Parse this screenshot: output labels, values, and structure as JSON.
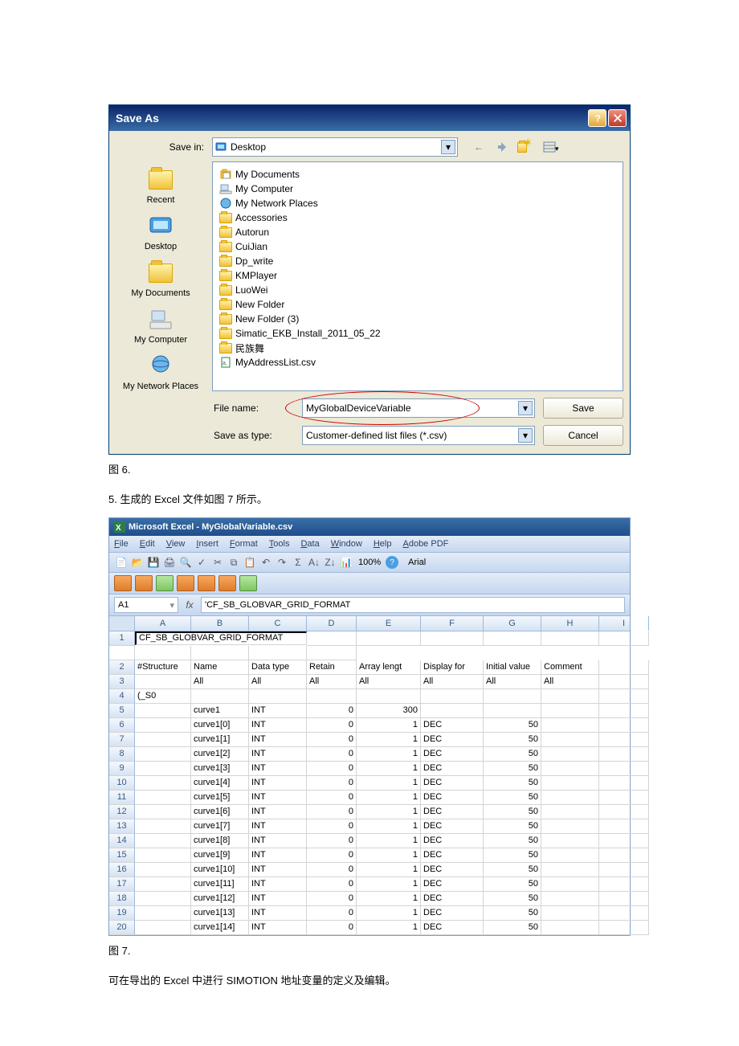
{
  "saveas": {
    "title": "Save As",
    "savein_lbl": "Save in:",
    "savein_val": "Desktop",
    "places": [
      "Recent",
      "Desktop",
      "My Documents",
      "My Computer",
      "My Network Places"
    ],
    "items": [
      "My Documents",
      "My Computer",
      "My Network Places",
      "Accessories",
      "Autorun",
      "CuiJian",
      "Dp_write",
      "KMPlayer",
      "LuoWei",
      "New Folder",
      "New Folder (3)",
      "Simatic_EKB_Install_2011_05_22",
      "民族舞",
      "MyAddressList.csv"
    ],
    "filename_lbl": "File name:",
    "filename_val": "MyGlobalDeviceVariable",
    "savetype_lbl": "Save as type:",
    "savetype_val": "Customer-defined list files (*.csv)",
    "save_btn": "Save",
    "cancel_btn": "Cancel"
  },
  "caption1": "图 6.",
  "para1": "5.  生成的 Excel 文件如图 7 所示。",
  "excel": {
    "title": "Microsoft Excel - MyGlobalVariable.csv",
    "menus": [
      "File",
      "Edit",
      "View",
      "Insert",
      "Format",
      "Tools",
      "Data",
      "Window",
      "Help",
      "Adobe PDF"
    ],
    "zoom": "100%",
    "font": "Arial",
    "namebox": "A1",
    "formula": "'CF_SB_GLOBVAR_GRID_FORMAT",
    "cols": [
      "",
      "A",
      "B",
      "C",
      "D",
      "E",
      "F",
      "G",
      "H",
      "I"
    ],
    "rows": [
      {
        "n": "1",
        "A": "CF_SB_GLOBVAR_GRID_FORMAT",
        "cur": true
      },
      {
        "n": "2",
        "A": "#Structure",
        "B": "Name",
        "C": "Data type",
        "D": "Retain",
        "E": "Array lengt",
        "F": "Display for",
        "G": "Initial value",
        "H": "Comment"
      },
      {
        "n": "3",
        "B": "All",
        "C": "All",
        "D": "All",
        "E": "All",
        "F": "All",
        "G": "All",
        "H": "All"
      },
      {
        "n": "4",
        "A": "(_S0"
      },
      {
        "n": "5",
        "B": "curve1",
        "C": "INT",
        "D": "0",
        "E": "300"
      },
      {
        "n": "6",
        "B": "curve1[0]",
        "C": "INT",
        "D": "0",
        "E": "1",
        "F": "DEC",
        "G": "50"
      },
      {
        "n": "7",
        "B": "curve1[1]",
        "C": "INT",
        "D": "0",
        "E": "1",
        "F": "DEC",
        "G": "50"
      },
      {
        "n": "8",
        "B": "curve1[2]",
        "C": "INT",
        "D": "0",
        "E": "1",
        "F": "DEC",
        "G": "50"
      },
      {
        "n": "9",
        "B": "curve1[3]",
        "C": "INT",
        "D": "0",
        "E": "1",
        "F": "DEC",
        "G": "50"
      },
      {
        "n": "10",
        "B": "curve1[4]",
        "C": "INT",
        "D": "0",
        "E": "1",
        "F": "DEC",
        "G": "50"
      },
      {
        "n": "11",
        "B": "curve1[5]",
        "C": "INT",
        "D": "0",
        "E": "1",
        "F": "DEC",
        "G": "50"
      },
      {
        "n": "12",
        "B": "curve1[6]",
        "C": "INT",
        "D": "0",
        "E": "1",
        "F": "DEC",
        "G": "50"
      },
      {
        "n": "13",
        "B": "curve1[7]",
        "C": "INT",
        "D": "0",
        "E": "1",
        "F": "DEC",
        "G": "50"
      },
      {
        "n": "14",
        "B": "curve1[8]",
        "C": "INT",
        "D": "0",
        "E": "1",
        "F": "DEC",
        "G": "50"
      },
      {
        "n": "15",
        "B": "curve1[9]",
        "C": "INT",
        "D": "0",
        "E": "1",
        "F": "DEC",
        "G": "50"
      },
      {
        "n": "16",
        "B": "curve1[10]",
        "C": "INT",
        "D": "0",
        "E": "1",
        "F": "DEC",
        "G": "50"
      },
      {
        "n": "17",
        "B": "curve1[11]",
        "C": "INT",
        "D": "0",
        "E": "1",
        "F": "DEC",
        "G": "50"
      },
      {
        "n": "18",
        "B": "curve1[12]",
        "C": "INT",
        "D": "0",
        "E": "1",
        "F": "DEC",
        "G": "50"
      },
      {
        "n": "19",
        "B": "curve1[13]",
        "C": "INT",
        "D": "0",
        "E": "1",
        "F": "DEC",
        "G": "50"
      },
      {
        "n": "20",
        "B": "curve1[14]",
        "C": "INT",
        "D": "0",
        "E": "1",
        "F": "DEC",
        "G": "50"
      }
    ]
  },
  "caption2": "图 7.",
  "para2": "可在导出的 Excel 中进行 SIMOTION 地址变量的定义及编辑。"
}
